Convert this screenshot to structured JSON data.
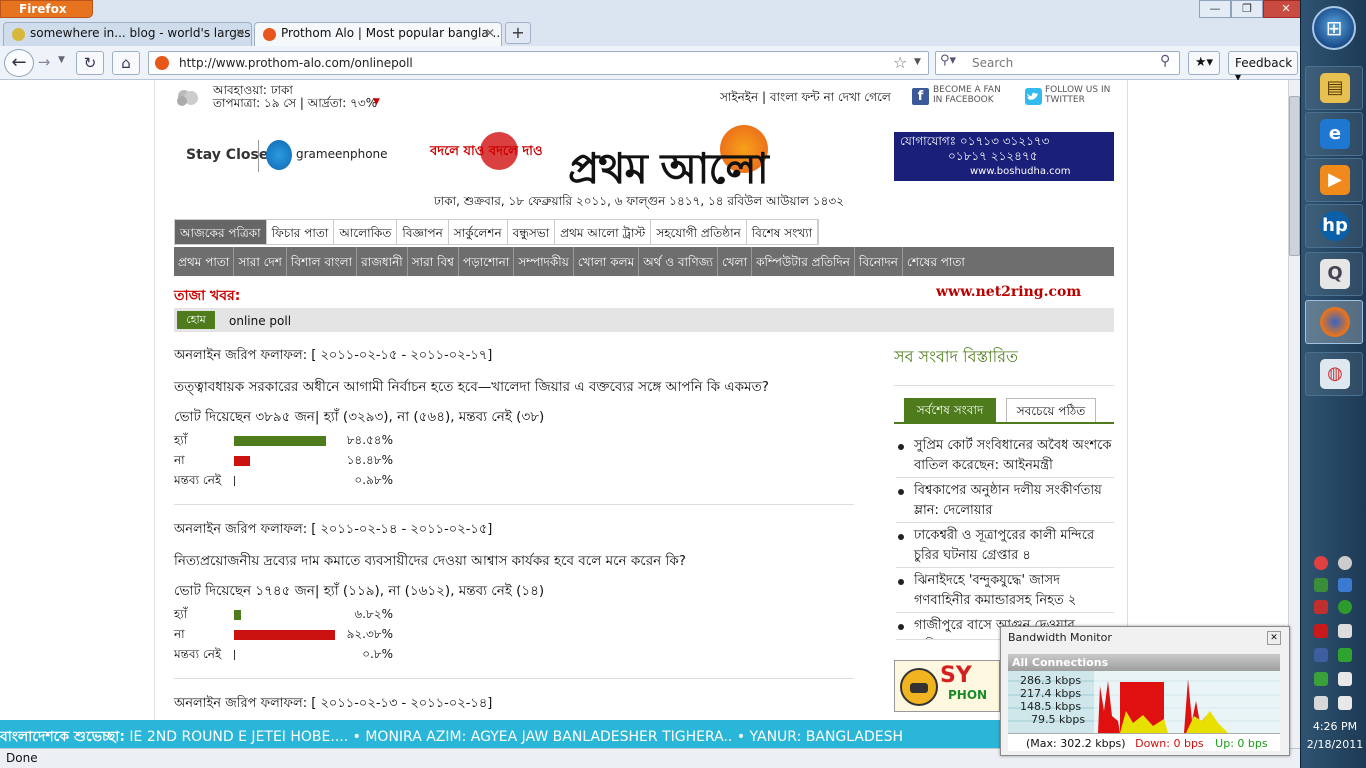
{
  "browser": {
    "menu_button": "Firefox",
    "window_controls": [
      "—",
      "❐",
      "✕"
    ],
    "tabs": [
      {
        "title": "somewhere in... blog - world's larges...",
        "active": false
      },
      {
        "title": "Prothom Alo | Most popular bangla ...",
        "active": true
      }
    ],
    "url": "http://www.prothom-alo.com/onlinepoll",
    "search_placeholder": "Search",
    "feedback_label": "Feedback",
    "status": "Done"
  },
  "header": {
    "weather_line1": "আবহাওয়া: ঢাকা",
    "weather_line2": "তাপমাত্রা: ১৯ সে | আর্দ্রতা: ৭৩%",
    "signin": "সাইনইন | বাংলা ফন্ট না দেখা গেলে",
    "facebook": "BECOME A FAN IN FACEBOOK",
    "twitter": "FOLLOW US IN TWITTER",
    "sponsor_left": "Stay Close",
    "sponsor_brand": "grameenphone",
    "slogan": "বদলে যাও বদলে দাও",
    "masthead": "প্রথম আলো",
    "boshudha_line1": "যোগাযোগঃ ০১৭১৩ ৩১২১৭৩",
    "boshudha_line2": "০১৮১৭ ২১২৪৭৫",
    "boshudha_line3": "www.boshudha.com",
    "dateline": "ঢাকা, শুক্রবার, ১৮ ফেব্রুয়ারি ২০১১, ৬ ফাল্গুন ১৪১৭, ১৪ রবিউল আউয়াল ১৪৩২"
  },
  "nav_primary": [
    "আজকের পত্রিকা",
    "ফিচার পাতা",
    "আলোকিত",
    "বিজ্ঞাপন",
    "সার্কুলেশন",
    "বন্ধুসভা",
    "প্রথম আলো ট্রাস্ট",
    "সহযোগী প্রতিষ্ঠান",
    "বিশেষ সংখ্যা"
  ],
  "nav_secondary": [
    "প্রথম পাতা",
    "সারা দেশ",
    "বিশাল বাংলা",
    "রাজধানী",
    "সারা বিশ্ব",
    "পড়াশোনা",
    "সম্পাদকীয়",
    "খোলা কলম",
    "অর্থ ও বাণিজ্য",
    "খেলা",
    "কম্পিউটার প্রতিদিন",
    "বিনোদন",
    "শেষের পাতা"
  ],
  "breaking_label": "তাজা খবর:",
  "net2ring": "www.net2ring.com",
  "breadcrumb": {
    "home": "হোম",
    "current": "online poll"
  },
  "polls": [
    {
      "title": "অনলাইন জরিপ ফলাফল: [ ২০১১-০২-১৫ - ২০১১-০২-১৭]",
      "question": "তত্ত্বাবধায়ক সরকারের অধীনে আগামী নির্বাচন হতে হবে—খালেদা জিয়ার এ বক্তব্যের সঙ্গে আপনি কি একমত?",
      "votes": "ভোট দিয়েছেন ৩৮৯৫ জন| হ্যাঁ (৩২৯৩), না (৫৬৪), মন্তব্য নেই (৩৮)",
      "rows": [
        {
          "label": "হ্যাঁ",
          "pct_text": "৮৪.৫৪%",
          "pct": 84.54,
          "color": "#4e7c1c"
        },
        {
          "label": "না",
          "pct_text": "১৪.৪৮%",
          "pct": 14.48,
          "color": "#cc1111"
        },
        {
          "label": "মন্তব্য নেই",
          "pct_text": "০.৯৮%",
          "pct": 0.98,
          "color": "#333333"
        }
      ]
    },
    {
      "title": "অনলাইন জরিপ ফলাফল: [ ২০১১-০২-১৪ - ২০১১-০২-১৫]",
      "question": "নিত্যপ্রয়োজনীয় দ্রব্যের দাম কমাতে ব্যবসায়ীদের দেওয়া আশ্বাস কার্যকর হবে বলে মনে করেন কি?",
      "votes": "ভোট দিয়েছেন ১৭৪৫ জন| হ্যাঁ (১১৯), না (১৬১২), মন্তব্য নেই (১৪)",
      "rows": [
        {
          "label": "হ্যাঁ",
          "pct_text": "৬.৮২%",
          "pct": 6.82,
          "color": "#4e7c1c"
        },
        {
          "label": "না",
          "pct_text": "৯২.৩৮%",
          "pct": 92.38,
          "color": "#cc1111"
        },
        {
          "label": "মন্তব্য নেই",
          "pct_text": "০.৮%",
          "pct": 0.8,
          "color": "#333333"
        }
      ]
    },
    {
      "title": "অনলাইন জরিপ ফলাফল: [ ২০১১-০২-১৩ - ২০১১-০২-১৪]"
    }
  ],
  "sidebar": {
    "heading": "সব সংবাদ বিস্তারিত",
    "tab_latest": "সর্বশেষ সংবাদ",
    "tab_popular": "সবচেয়ে পঠিত",
    "news": [
      "সুপ্রিম কোর্ট সংবিধানের অবৈধ অংশকে বাতিল করেছেন: আইনমন্ত্রী",
      "বিশ্বকাপের অনুষ্ঠান দলীয় সংকীর্ণতায় ম্লান: দেলোয়ার",
      "ঢাকেশ্বরী ও সূত্রাপুরের কালী মন্দিরে চুরির ঘটনায় গ্রেপ্তার ৪",
      "ঝিনাইদহে 'বন্দুকযুদ্ধে' জাসদ গণবাহিনীর কমান্ডারসহ নিহত ২",
      "গাজীপুরে বাসে আগুন দেওয়ার অভিযোগ ৫"
    ],
    "banner_text": "SY",
    "banner_sub": "PHON"
  },
  "ticker": {
    "label": "বাংলাদেশকে শুভেচ্ছা:",
    "text": "IE 2ND ROUND E JETEI HOBE....  • MONIRA AZIM: AGYEA JAW BANLADESHER TIGHERA..  • YANUR: BANGLADESH"
  },
  "bandwidth_monitor": {
    "title": "Bandwidth Monitor",
    "header": "All Connections",
    "scale": [
      "286.3 kbps",
      "217.4 kbps",
      "148.5 kbps",
      "79.5 kbps"
    ],
    "max": "(Max: 302.2 kbps)",
    "down": "Down: 0 bps",
    "up": "Up: 0 bps"
  },
  "taskbar": {
    "apps": [
      "explorer",
      "ie",
      "media-player",
      "hp",
      "q",
      "firefox",
      "paint"
    ],
    "time": "4:26 PM",
    "date": "2/18/2011"
  }
}
